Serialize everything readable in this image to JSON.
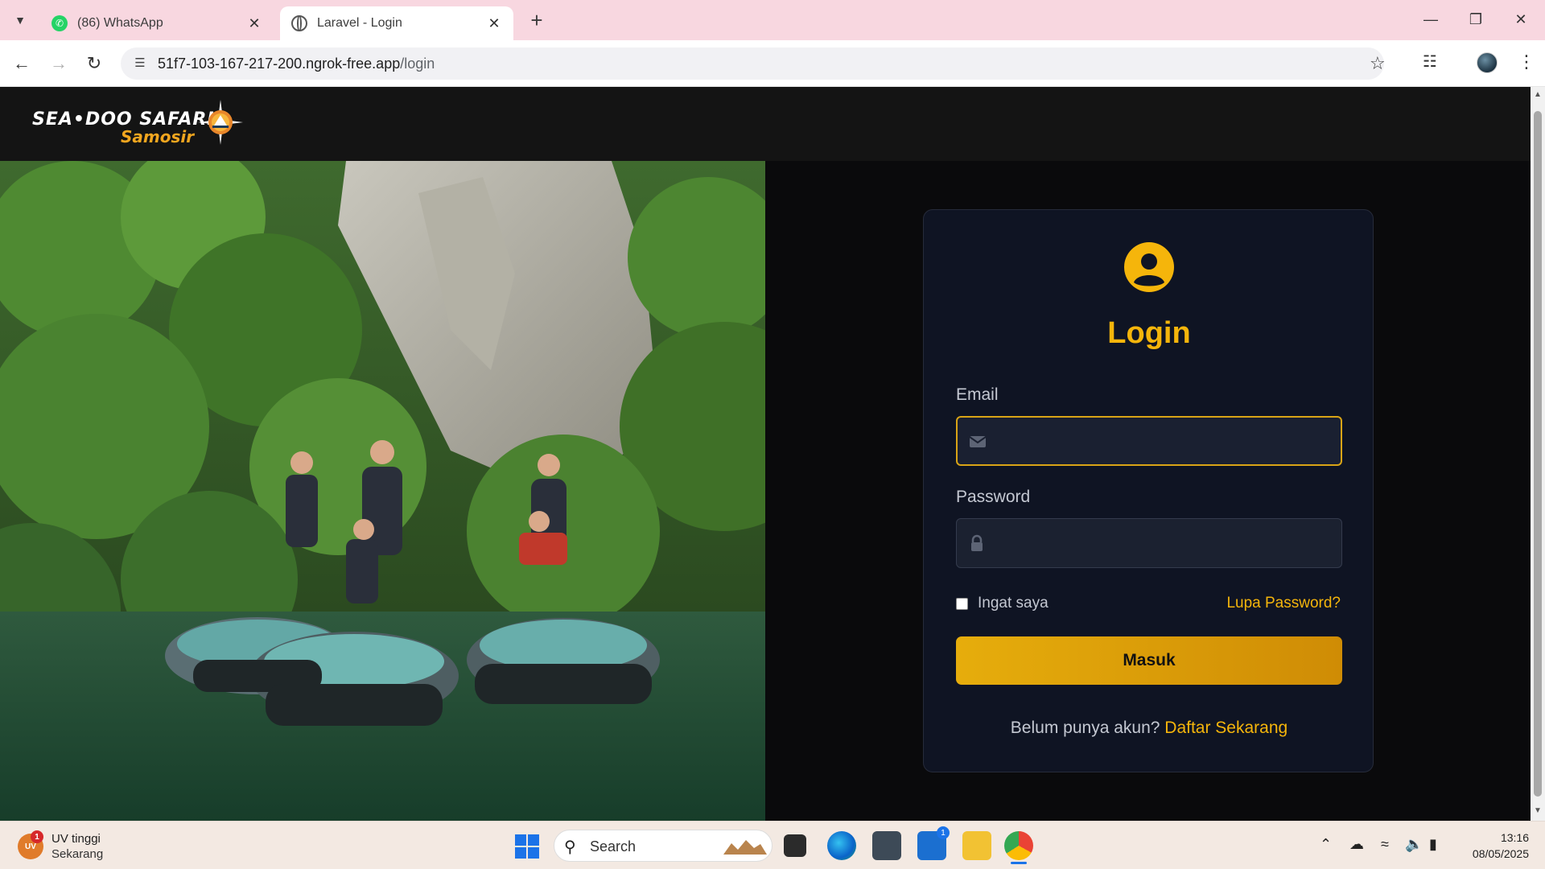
{
  "browser": {
    "tabs": [
      {
        "title": "(86) WhatsApp",
        "icon": "whatsapp-icon",
        "active": false
      },
      {
        "title": "Laravel - Login",
        "icon": "globe-icon",
        "active": true
      }
    ],
    "url_host": "51f7-103-167-217-200.ngrok-free.app",
    "url_path": "/login"
  },
  "site": {
    "logo_main": "SEA•DOO SAFARI",
    "logo_sub": "Samosir"
  },
  "login": {
    "title": "Login",
    "email_label": "Email",
    "email_value": "",
    "password_label": "Password",
    "password_value": "",
    "remember_label": "Ingat saya",
    "remember_checked": false,
    "forgot_label": "Lupa Password?",
    "submit_label": "Masuk",
    "register_prompt": "Belum punya akun?",
    "register_link": "Daftar Sekarang"
  },
  "colors": {
    "accent": "#f5b50b",
    "card_bg": "#0f1423",
    "page_bg": "#0a0a0c"
  },
  "taskbar": {
    "weather_badge": "UV",
    "weather_title": "UV tinggi",
    "weather_sub": "Sekarang",
    "weather_count": "1",
    "search_label": "Search",
    "store_badge": "1",
    "time": "13:16",
    "date": "08/05/2025"
  }
}
